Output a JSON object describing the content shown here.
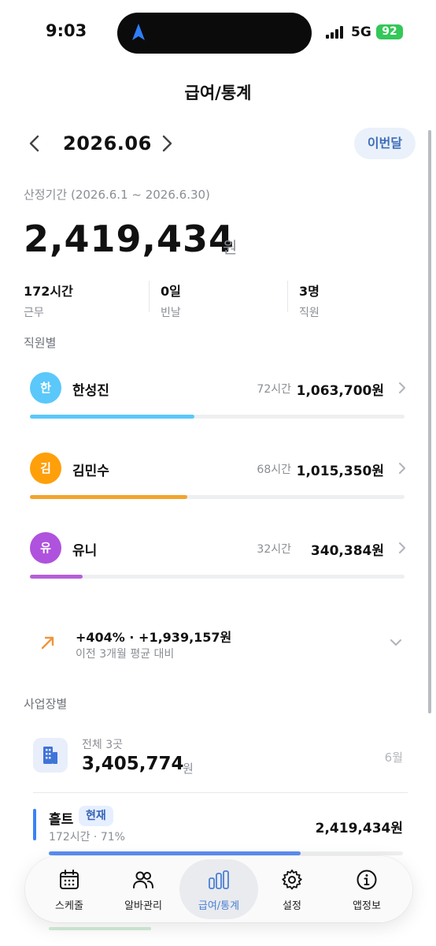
{
  "status_bar": {
    "time": "9:03",
    "network": "5G",
    "battery": "92"
  },
  "header": {
    "title": "급여/통계"
  },
  "month_nav": {
    "label": "2026.06",
    "this_month_button": "이번달"
  },
  "summary": {
    "period": "산정기간 (2026.6.1 ~ 2026.6.30)",
    "total": "2,419,434",
    "unit": "원",
    "stats": [
      {
        "value": "172시간",
        "label": "근무"
      },
      {
        "value": "0일",
        "label": "빈날"
      },
      {
        "value": "3명",
        "label": "직원"
      }
    ]
  },
  "employees_section": {
    "title": "직원별",
    "items": [
      {
        "initial": "한",
        "name": "한성진",
        "hours": "72시간",
        "amount": "1,063,700원",
        "color": "#5ac8fa",
        "bar_color": "#5ac8fa",
        "ratio": 0.44
      },
      {
        "initial": "김",
        "name": "김민수",
        "hours": "68시간",
        "amount": "1,015,350원",
        "color": "#ff9f0a",
        "bar_color": "#f2a42c",
        "ratio": 0.42
      },
      {
        "initial": "유",
        "name": "유니",
        "hours": "32시간",
        "amount": "340,384원",
        "color": "#af52de",
        "bar_color": "#b65fd8",
        "ratio": 0.14
      }
    ]
  },
  "comparison": {
    "main": "+404% · +1,939,157원",
    "sub": "이전 3개월 평균 대비",
    "arrow_color": "#f0953a"
  },
  "business_section": {
    "title": "사업장별",
    "summary_sub": "전체 3곳",
    "summary_total": "3,405,774",
    "summary_unit": "원",
    "month_label": "6월",
    "stores": [
      {
        "name": "홀트",
        "badge": "현재",
        "meta": "172시간 · 71%",
        "amount": "2,419,434원",
        "ratio": 0.71
      }
    ]
  },
  "tab_bar": {
    "tabs": [
      {
        "label": "스케줄",
        "icon": "calendar-icon"
      },
      {
        "label": "알바관리",
        "icon": "people-icon"
      },
      {
        "label": "급여/통계",
        "icon": "bar-chart-icon",
        "active": true
      },
      {
        "label": "설정",
        "icon": "gear-icon"
      },
      {
        "label": "앱정보",
        "icon": "info-icon"
      }
    ]
  },
  "colors": {
    "accent": "#3d6fb8",
    "active_tab": "#4a7fd6"
  }
}
